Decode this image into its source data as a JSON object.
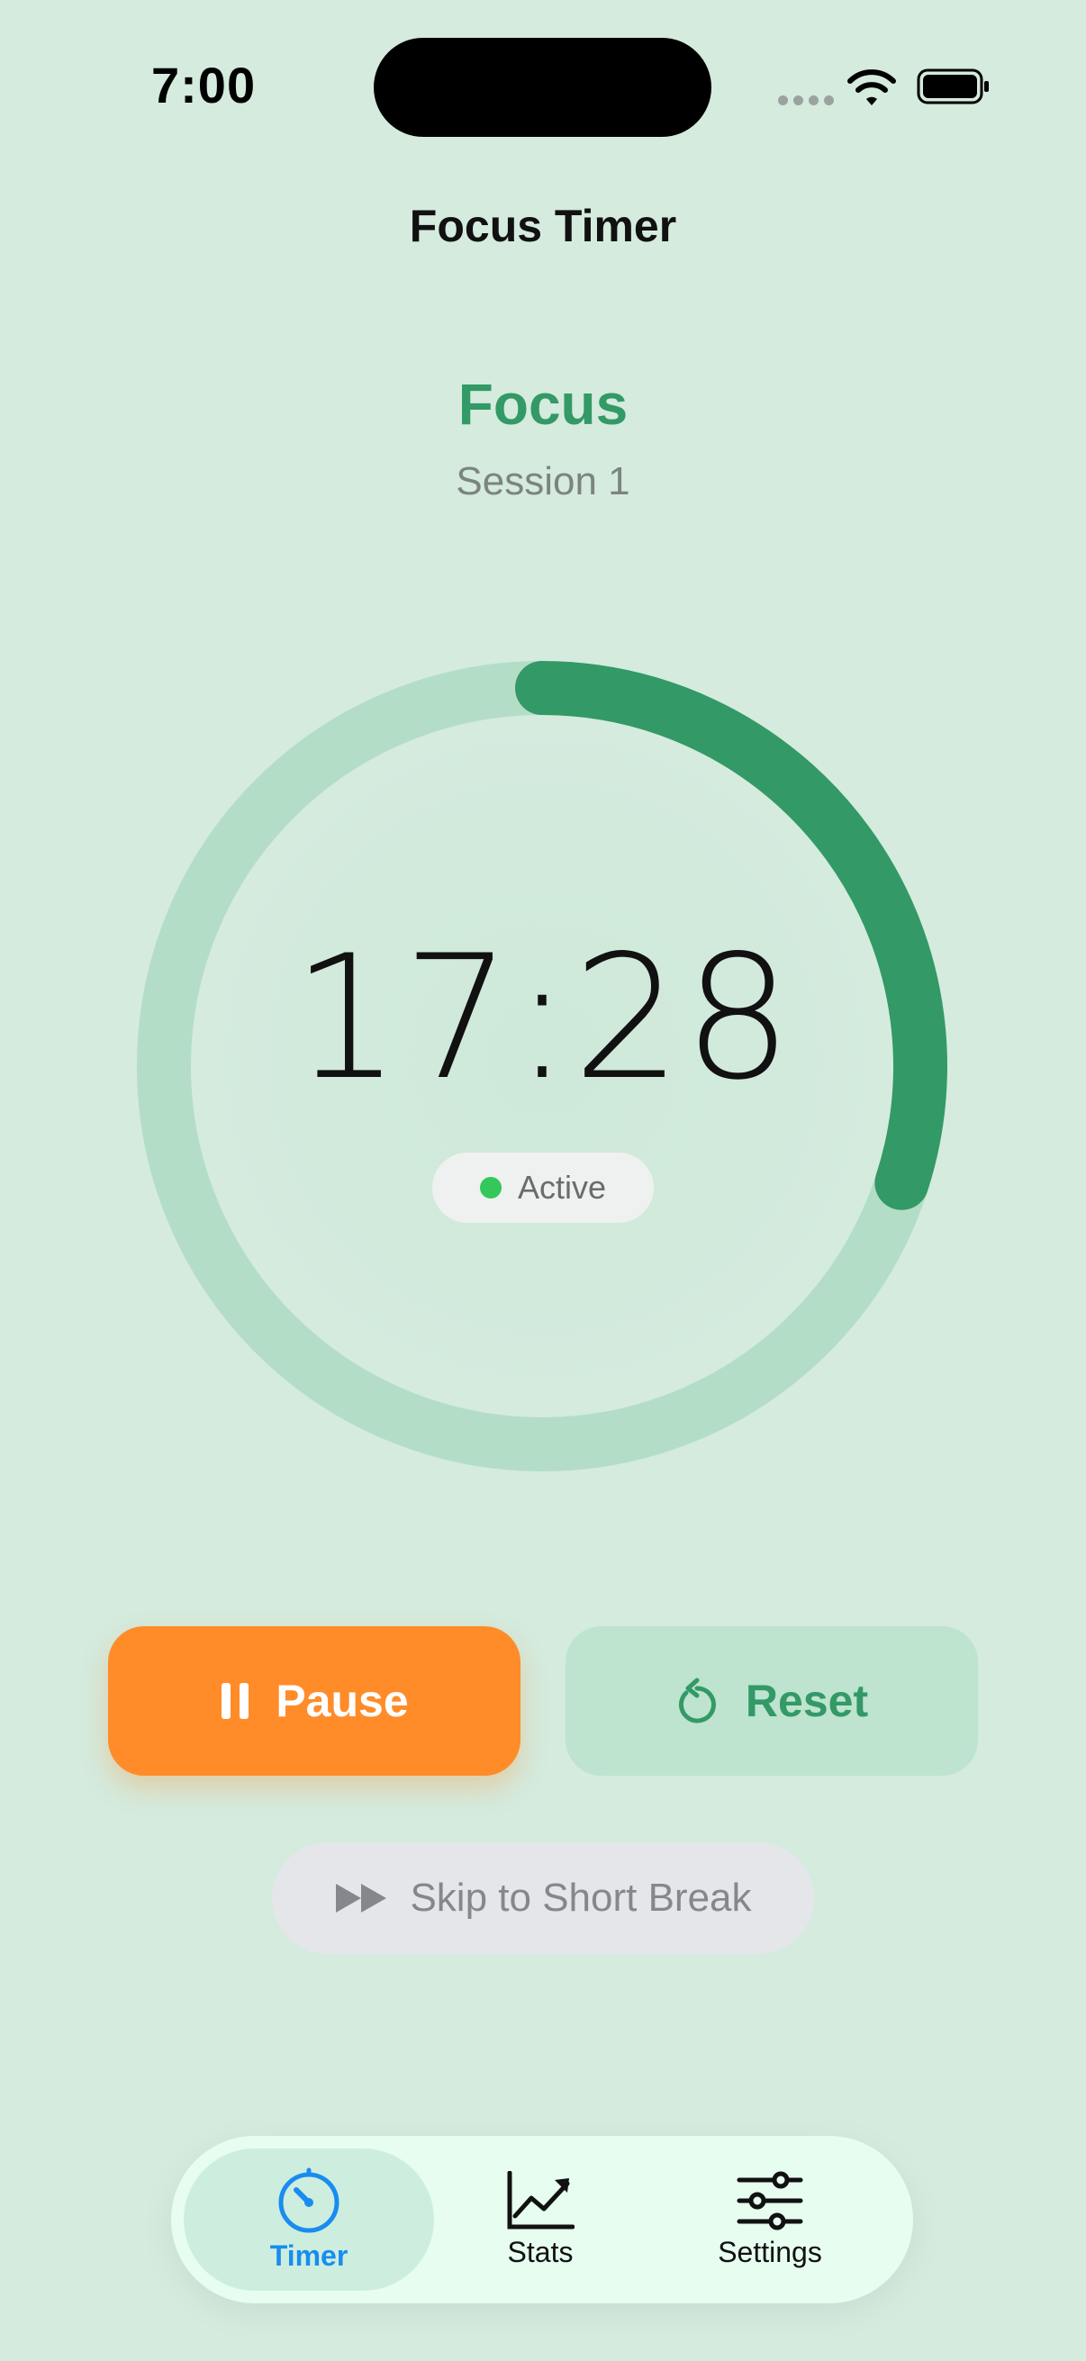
{
  "status_bar": {
    "time": "7:00"
  },
  "header": {
    "title": "Focus Timer"
  },
  "session": {
    "mode": "Focus",
    "label": "Session 1"
  },
  "timer": {
    "remaining": "17:28",
    "status": "Active",
    "progress_fraction": 0.3
  },
  "controls": {
    "pause_label": "Pause",
    "reset_label": "Reset",
    "skip_label": "Skip to Short Break"
  },
  "tabs": [
    {
      "label": "Timer",
      "icon": "timer-icon",
      "selected": true
    },
    {
      "label": "Stats",
      "icon": "chart-icon",
      "selected": false
    },
    {
      "label": "Settings",
      "icon": "sliders-icon",
      "selected": false
    }
  ],
  "colors": {
    "background": "#d4ebde",
    "accent_green": "#339966",
    "ring_track": "#b4ddc8",
    "pause_orange": "#ff8c29",
    "active_dot": "#34c759",
    "tab_selected": "#1a8cf0"
  }
}
